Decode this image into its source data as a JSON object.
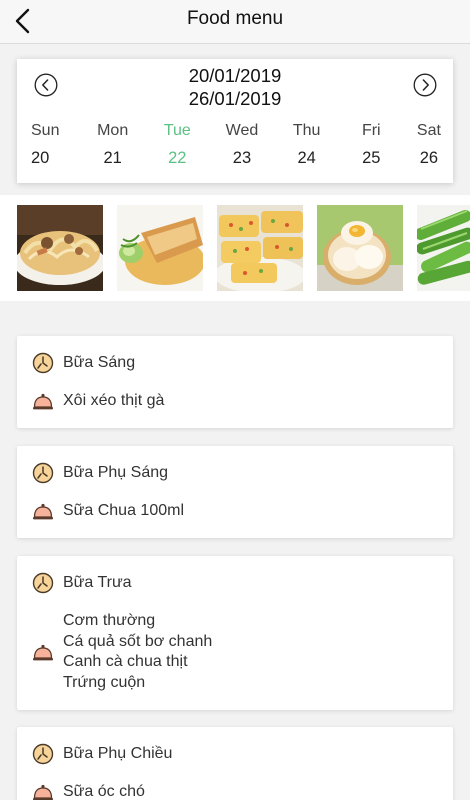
{
  "header": {
    "title": "Food menu",
    "back_icon": "chevron-left-icon"
  },
  "week": {
    "range_start": "20/01/2019",
    "range_end": "26/01/2019",
    "prev_icon": "circle-chevron-left-icon",
    "next_icon": "circle-chevron-right-icon",
    "accent_color": "#5cc184",
    "days": [
      {
        "name": "Sun",
        "num": "20",
        "active": false
      },
      {
        "name": "Mon",
        "num": "21",
        "active": false
      },
      {
        "name": "Tue",
        "num": "22",
        "active": true
      },
      {
        "name": "Wed",
        "num": "23",
        "active": false
      },
      {
        "name": "Thu",
        "num": "24",
        "active": false
      },
      {
        "name": "Fri",
        "num": "25",
        "active": false
      },
      {
        "name": "Sat",
        "num": "26",
        "active": false
      }
    ]
  },
  "photos": [
    "noodle-soup-photo",
    "fish-fillet-photo",
    "rolled-omelette-photo",
    "boiled-eggs-photo",
    "green-vegetable-photo"
  ],
  "meals": [
    {
      "title": "Bữa Sáng",
      "dishes": [
        "Xôi xéo thịt gà"
      ]
    },
    {
      "title": "Bữa Phụ Sáng",
      "dishes": [
        "Sữa Chua 100ml"
      ]
    },
    {
      "title": "Bữa Trưa",
      "dishes": [
        "Cơm thường",
        "Cá quả sốt bơ chanh",
        "Canh cà chua thịt",
        "Trứng cuộn"
      ]
    },
    {
      "title": "Bữa Phụ Chiều",
      "dishes": [
        "Sữa óc chó"
      ]
    }
  ]
}
